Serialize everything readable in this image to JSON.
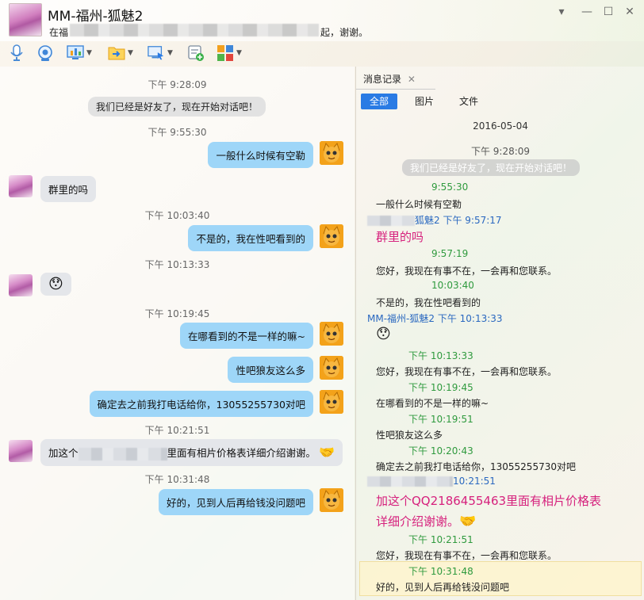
{
  "window": {
    "title": "MM-福州-狐魅2",
    "subtitle_prefix": "在福",
    "subtitle_suffix": "起，谢谢。",
    "controls": [
      "▾",
      "—",
      "☐",
      "✕"
    ]
  },
  "toolbar": {
    "icons": [
      "microphone-icon",
      "camera-icon",
      "screen-share-icon",
      "file-transfer-icon",
      "remote-desktop-icon",
      "add-note-icon",
      "apps-icon"
    ]
  },
  "chat": {
    "ts1": "下午 9:28:09",
    "sys1": "我们已经是好友了，现在开始对话吧！",
    "ts2": "下午 9:55:30",
    "m1": "一般什么时候有空勒",
    "m2": "群里的吗",
    "ts3": "下午 10:03:40",
    "m3": "不是的，我在性吧看到的",
    "ts4": "下午 10:13:33",
    "m4_emoji": "😯",
    "ts5": "下午 10:19:45",
    "m5": "在哪看到的不是一样的嘛~",
    "m6": "性吧狼友这么多",
    "m7": "确定去之前我打电话给你，13055255730对吧",
    "ts6": "下午 10:21:51",
    "m8_prefix": "加这个",
    "m8_suffix": "里面有相片价格表详细介绍谢谢。",
    "m8_emoji": "🤝",
    "ts7": "下午 10:31:48",
    "m9": "好的，见到人后再给钱没问题吧"
  },
  "history": {
    "tab_label": "消息记录",
    "tab_close": "✕",
    "filters": [
      "全部",
      "图片",
      "文件"
    ],
    "date": "2016-05-04",
    "h_ts1": "下午 9:28:09",
    "h_sys": "我们已经是好友了，现在开始对话吧！",
    "h1_time": "9:55:30",
    "h1_text": "一般什么时候有空勒",
    "h2_head": "狐魅2 下午 9:57:17",
    "h2_text": "群里的吗",
    "h3_time": "9:57:19",
    "h3_text": "您好，我现在有事不在，一会再和您联系。",
    "h4_time": "10:03:40",
    "h4_text": "不是的，我在性吧看到的",
    "h5_head": "MM-福州-狐魅2 下午 10:13:33",
    "h5_emoji": "😯",
    "h6_time": "下午 10:13:33",
    "h6_text": "您好，我现在有事不在，一会再和您联系。",
    "h7_time": "下午 10:19:45",
    "h7_text": "在哪看到的不是一样的嘛~",
    "h8_time": "下午 10:19:51",
    "h8_text": "性吧狼友这么多",
    "h9_time": "下午 10:20:43",
    "h9_text": "确定去之前我打电话给你，13055255730对吧",
    "h10_head": "10:21:51",
    "h10_text1": "加这个QQ2186455463里面有相片价格表",
    "h10_text2": "详细介绍谢谢。",
    "h10_emoji": "🤝",
    "h11_time": "下午 10:21:51",
    "h11_text": "您好，我现在有事不在，一会再和您联系。",
    "h12_time": "下午 10:31:48",
    "h12_text": "好的，见到人后再给钱没问题吧"
  },
  "colors": {
    "accent_blue": "#2a7be4",
    "bubble_me": "#9ed6f8",
    "bubble_other": "#e4e6ea",
    "time_green": "#2f9a3e",
    "name_blue": "#2a68c0",
    "pink_text": "#d6217d"
  }
}
